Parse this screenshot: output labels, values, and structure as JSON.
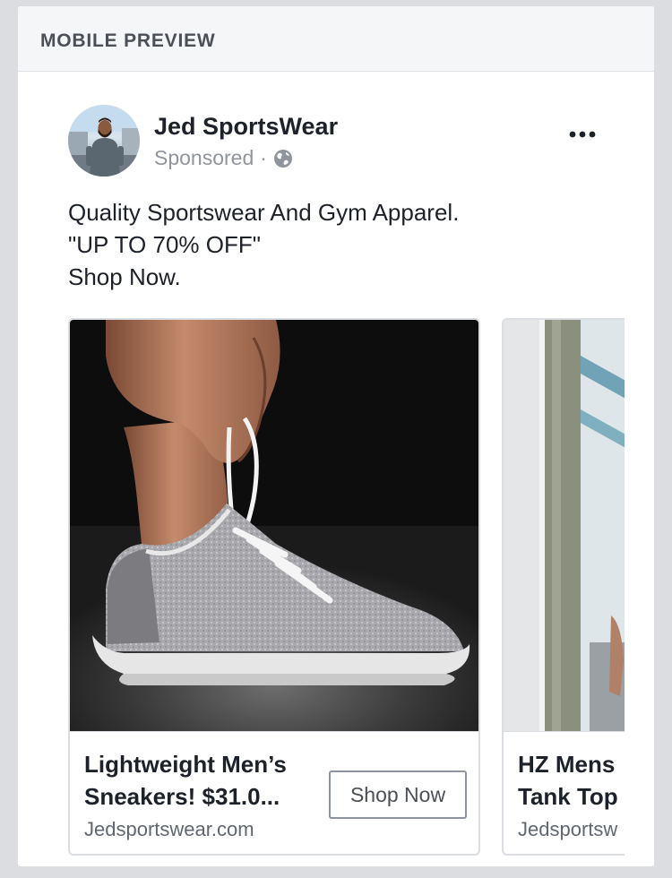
{
  "header": {
    "title": "MOBILE PREVIEW"
  },
  "post": {
    "page_name": "Jed SportsWear",
    "sponsored_label": "Sponsored",
    "separator": "·",
    "audience_icon": "globe-icon",
    "more_icon": "more-options-icon",
    "body_lines": [
      "Quality Sportswear And Gym Apparel.",
      "\"UP TO 70% OFF\"",
      "Shop Now."
    ]
  },
  "carousel": {
    "cards": [
      {
        "title_lines": [
          "Lightweight Men’s",
          "Sneakers! $31.0..."
        ],
        "url": "Jedsportswear.com",
        "cta_label": "Shop Now",
        "image": "grey-knit-sneaker-photo"
      },
      {
        "title_lines": [
          "HZ Mens",
          "Tank Top"
        ],
        "url": "Jedsportsw",
        "image": "outdoor-pillar-photo"
      }
    ]
  }
}
